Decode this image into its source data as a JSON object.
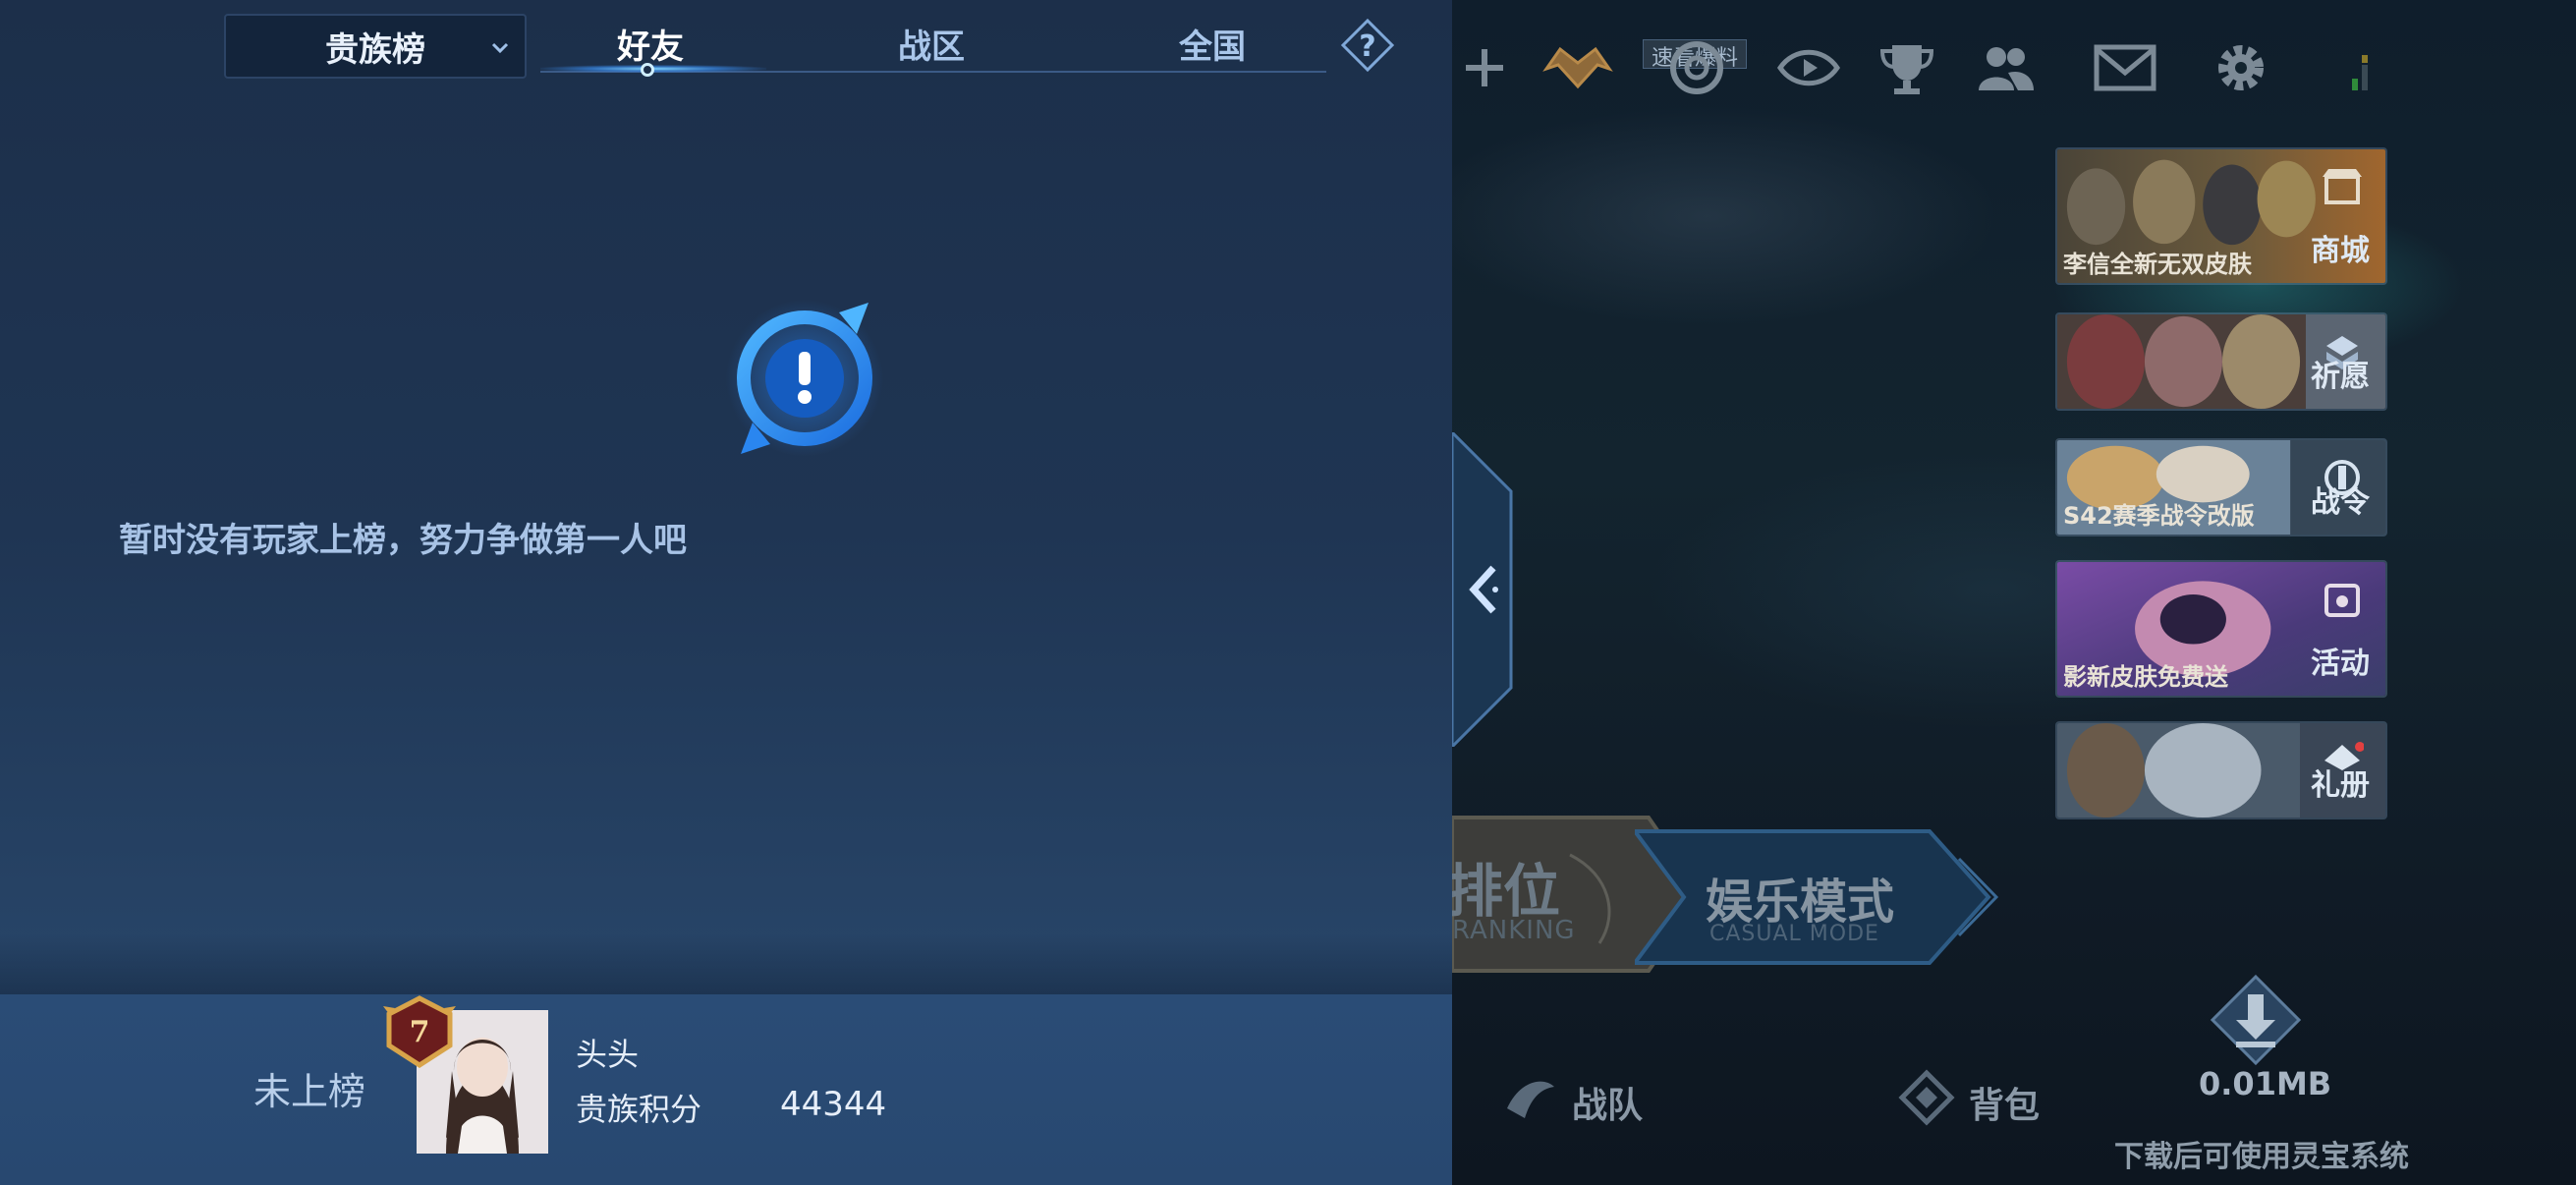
{
  "leaderboard": {
    "dropdown": {
      "selected": "贵族榜"
    },
    "tabs": [
      {
        "label": "好友",
        "active": true
      },
      {
        "label": "战区",
        "active": false
      },
      {
        "label": "全国",
        "active": false
      }
    ],
    "help_icon": "question-diamond-icon",
    "empty_state": {
      "icon": "exclamation-compass-icon",
      "text": "暂时没有玩家上榜，努力争做第一人吧"
    },
    "my_rank": {
      "status": "未上榜",
      "level_badge": "7",
      "name": "头头",
      "score_label": "贵族积分",
      "score_value": "44344"
    }
  },
  "lobby": {
    "news_tag": "速看爆料",
    "top_icons": [
      "add-icon",
      "crown-wings-icon",
      "target-icon",
      "eye-icon",
      "trophy-icon",
      "friends-icon",
      "mail-icon",
      "gear-icon",
      "signal-icon"
    ],
    "side_cards": [
      {
        "caption": "李信全新无双皮肤",
        "label": "商城",
        "icon": "shop-icon"
      },
      {
        "caption": "",
        "label": "祈愿",
        "icon": "wish-icon"
      },
      {
        "caption": "S42赛季战令改版",
        "label": "战令",
        "icon": "battlepass-icon"
      },
      {
        "caption": "影新皮肤免费送",
        "label": "活动",
        "icon": "event-icon"
      },
      {
        "caption": "",
        "label": "礼册",
        "icon": "gift-book-icon"
      }
    ],
    "modes": {
      "ranked": {
        "main": "排位",
        "sub": "RANKING"
      },
      "casual": {
        "main": "娱乐模式",
        "sub": "CASUAL MODE"
      }
    },
    "bottom_nav": [
      {
        "label": "战队",
        "icon": "team-icon"
      },
      {
        "label": "背包",
        "icon": "backpack-icon"
      }
    ],
    "download": {
      "size": "0.01MB",
      "note": "下载后可使用灵宝系统"
    }
  },
  "colors": {
    "panel_bg": "#1f3553",
    "footer_bg": "#2a4c76",
    "accent_glow": "#7fd3ff",
    "text_primary": "#e6eef9",
    "text_muted": "#a8c3e6"
  }
}
